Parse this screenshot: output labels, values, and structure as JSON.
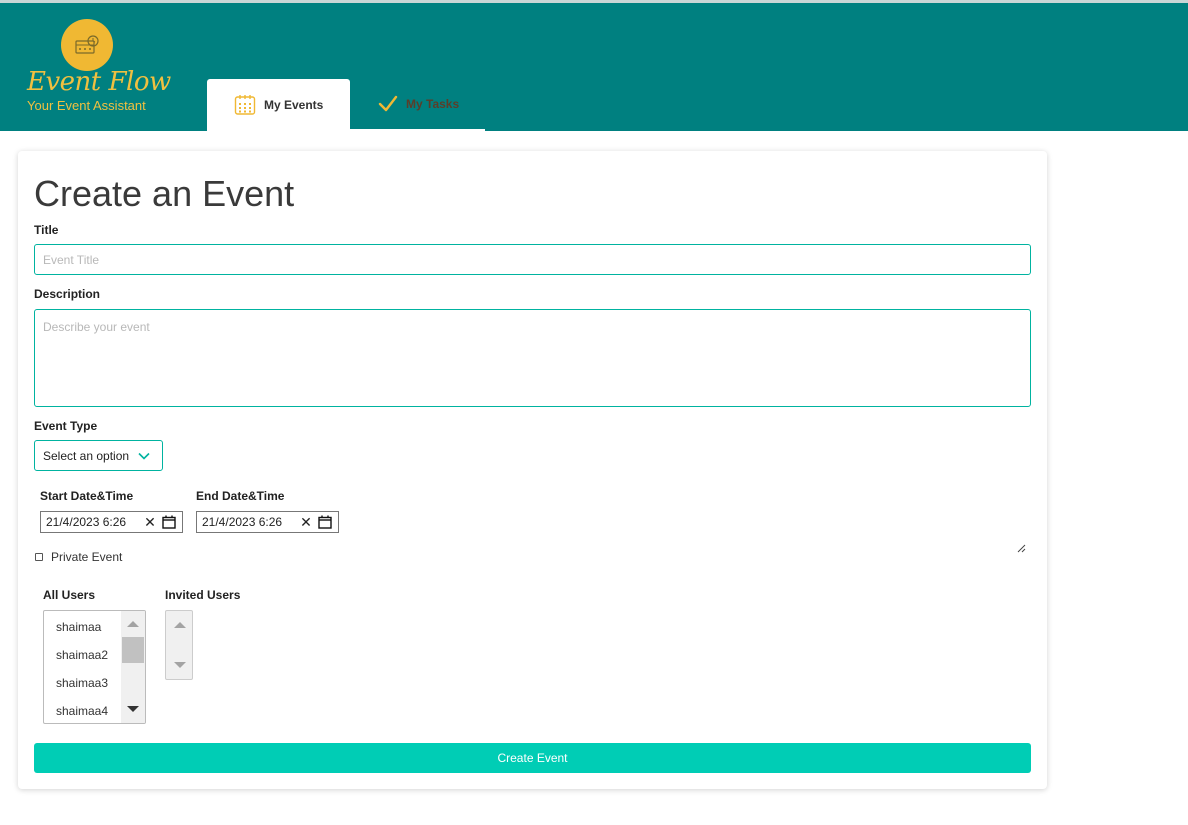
{
  "app": {
    "logo_script": "Event Flow",
    "logo_tagline": "Your Event Assistant"
  },
  "nav": {
    "tabs": [
      {
        "label": "My Events",
        "icon": "calendar-icon",
        "active": true
      },
      {
        "label": "My Tasks",
        "icon": "checkmark-icon",
        "active": false
      }
    ]
  },
  "form": {
    "heading": "Create an Event",
    "title_label": "Title",
    "title_placeholder": "Event Title",
    "title_value": "",
    "description_label": "Description",
    "description_placeholder": "Describe your event",
    "description_value": "",
    "event_type_label": "Event Type",
    "event_type_selected": "Select an option",
    "start_label": "Start Date&Time",
    "start_value": "21/4/2023  6:26",
    "end_label": "End Date&Time",
    "end_value": "21/4/2023  6:26",
    "private_label": "Private Event",
    "private_checked": false,
    "all_users_label": "All Users",
    "all_users": [
      "shaimaa",
      "shaimaa2",
      "shaimaa3",
      "shaimaa4"
    ],
    "invited_users_label": "Invited Users",
    "invited_users": [],
    "submit_label": "Create Event"
  },
  "colors": {
    "header": "#008080",
    "accent": "#00cdb5",
    "logo": "#f0b833"
  }
}
